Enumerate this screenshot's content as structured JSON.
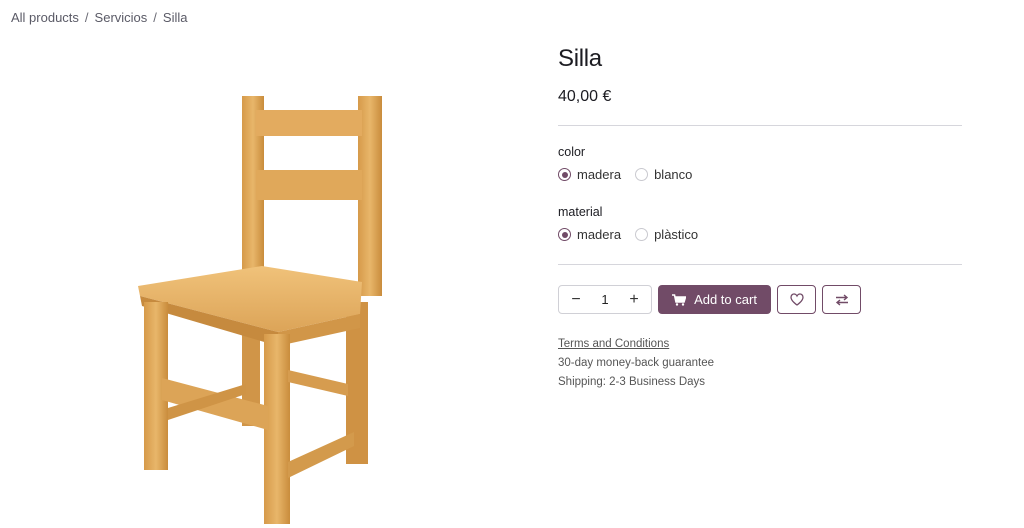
{
  "breadcrumb": {
    "items": [
      "All products",
      "Servicios",
      "Silla"
    ],
    "separator": "/"
  },
  "product": {
    "title": "Silla",
    "price": "40,00 €",
    "image_alt": "wooden chair",
    "wood_color": "#d8a456"
  },
  "attributes": {
    "color": {
      "label": "color",
      "options": [
        "madera",
        "blanco"
      ],
      "selected": "madera"
    },
    "material": {
      "label": "material",
      "options": [
        "madera",
        "plàstico"
      ],
      "selected": "madera"
    }
  },
  "cart": {
    "quantity": "1",
    "add_label": "Add to cart",
    "minus_symbol": "−",
    "plus_symbol": "+"
  },
  "info": {
    "terms": "Terms and Conditions",
    "guarantee": "30-day money-back guarantee",
    "shipping": "Shipping: 2-3 Business Days"
  },
  "colors": {
    "accent": "#714b67"
  }
}
